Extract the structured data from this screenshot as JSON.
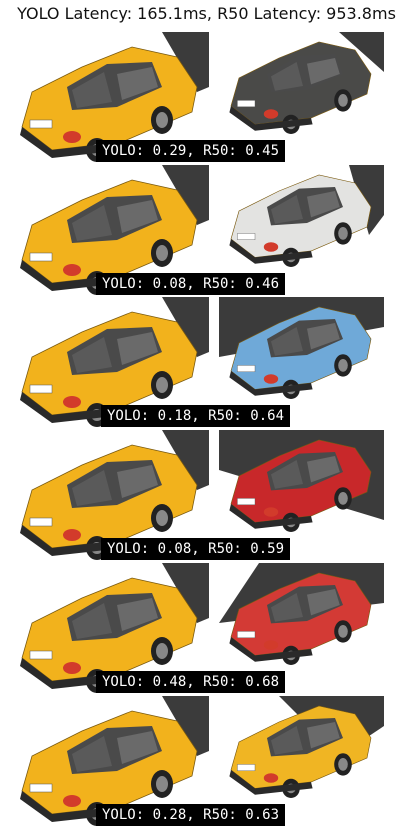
{
  "title": "YOLO Latency: 165.1ms, R50 Latency: 953.8ms",
  "query_car_color": "#f2b21c",
  "rows": [
    {
      "caption": "YOLO: 0.29, R50: 0.45",
      "match_car_color": "#4a4a48",
      "match_car_view": "rear"
    },
    {
      "caption": "YOLO: 0.08, R50: 0.46",
      "match_car_color": "#e3e3e1",
      "match_car_view": "rear"
    },
    {
      "caption": "YOLO: 0.18, R50: 0.64",
      "match_car_color": "#6fa9d8",
      "match_car_view": "rear"
    },
    {
      "caption": "YOLO: 0.08, R50: 0.59",
      "match_car_color": "#c8282a",
      "match_car_view": "rear"
    },
    {
      "caption": "YOLO: 0.48, R50: 0.68",
      "match_car_color": "#d33a35",
      "match_car_view": "rear"
    },
    {
      "caption": "YOLO: 0.28, R50: 0.63",
      "match_car_color": "#f0b523",
      "match_car_view": "side"
    }
  ]
}
